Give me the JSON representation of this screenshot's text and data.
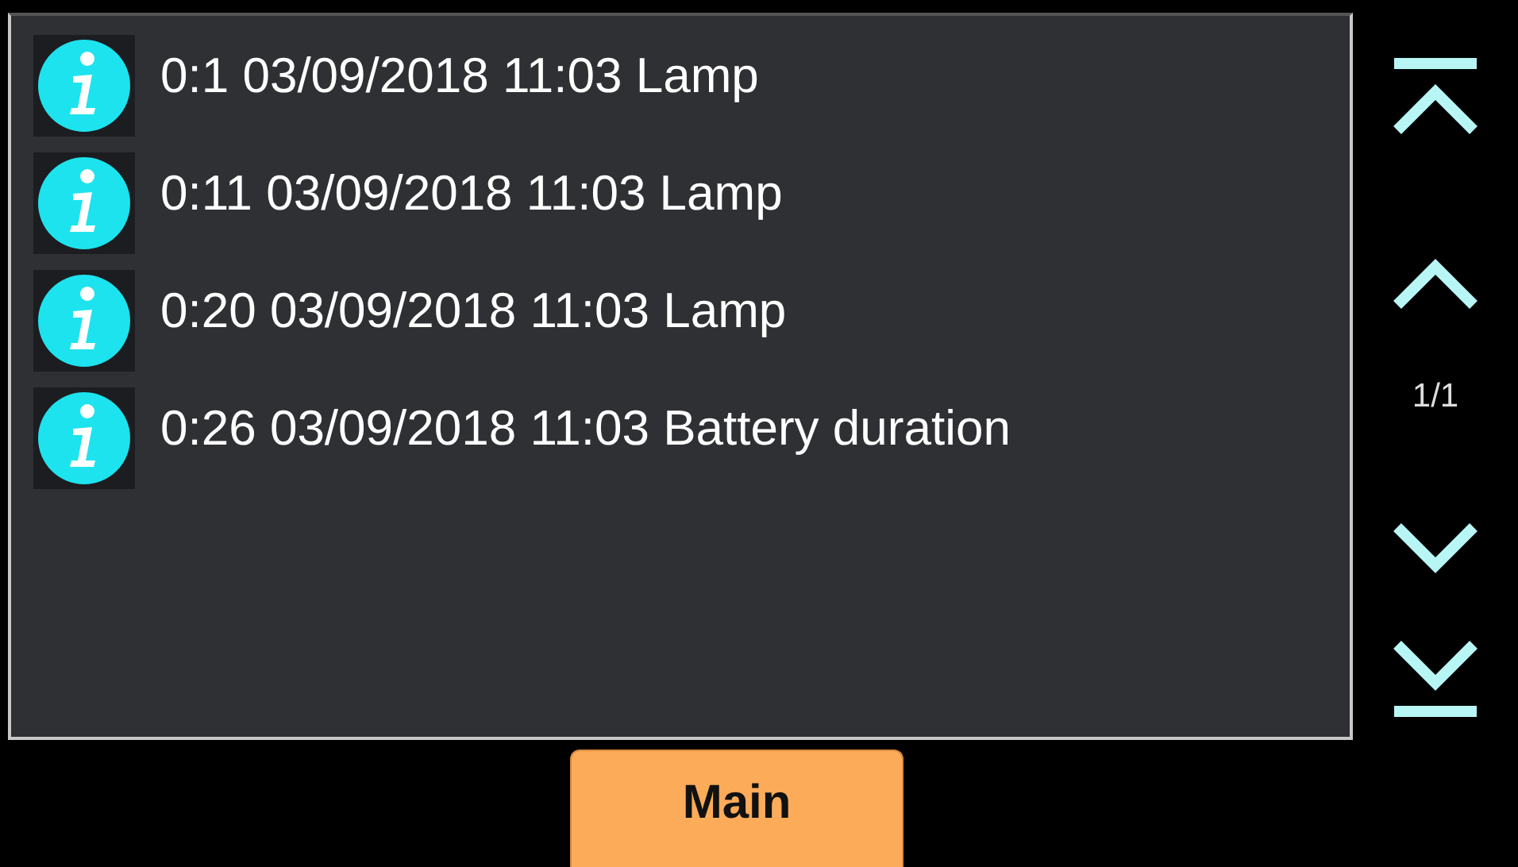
{
  "events": [
    {
      "text": "0:1 03/09/2018 11:03 Lamp",
      "kind": "info"
    },
    {
      "text": "0:11 03/09/2018 11:03 Lamp",
      "kind": "info"
    },
    {
      "text": "0:20 03/09/2018 11:03 Lamp",
      "kind": "info"
    },
    {
      "text": "0:26 03/09/2018 11:03 Battery duration",
      "kind": "info"
    }
  ],
  "pager": {
    "page": "1/1"
  },
  "buttons": [
    "Main"
  ]
}
